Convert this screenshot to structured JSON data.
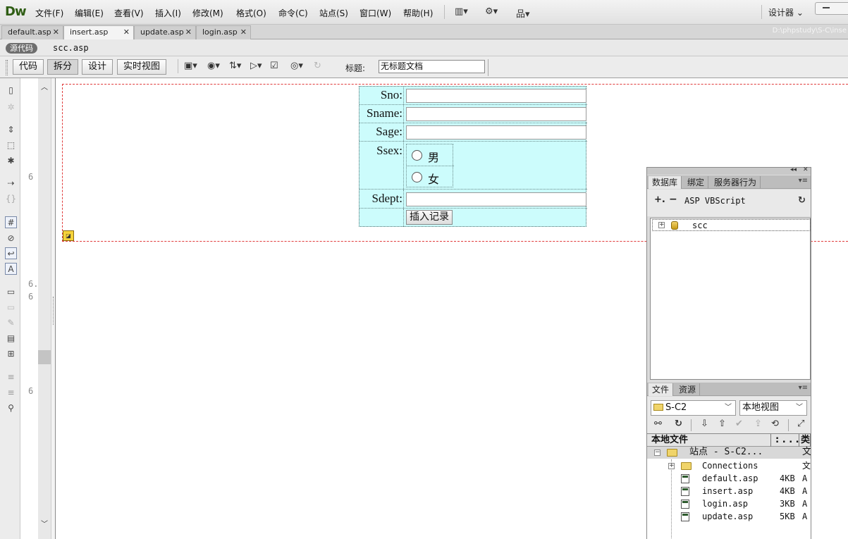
{
  "app": {
    "logo": "Dw",
    "menu": [
      "文件(F)",
      "编辑(E)",
      "查看(V)",
      "插入(I)",
      "修改(M)",
      "格式(O)",
      "命令(C)",
      "站点(S)",
      "窗口(W)",
      "帮助(H)"
    ],
    "workspace": "设计器"
  },
  "doc_tabs": [
    {
      "label": "default.asp",
      "active": false
    },
    {
      "label": "insert.asp",
      "active": true
    },
    {
      "label": "update.asp",
      "active": false
    },
    {
      "label": "login.asp",
      "active": false
    }
  ],
  "doc_path": "D:\\phpstudy\\S-C\\inse",
  "related": {
    "source": "源代码",
    "file": "scc.asp"
  },
  "toolbar": {
    "views": [
      "代码",
      "拆分",
      "设计",
      "实时视图"
    ],
    "active_view": "拆分",
    "title_label": "标题:",
    "title_value": "无标题文档"
  },
  "gutter": {
    "numbers": [
      "6",
      "6.",
      "6",
      "6"
    ]
  },
  "form": {
    "fields": [
      {
        "label": "Sno:",
        "value": ""
      },
      {
        "label": "Sname:",
        "value": ""
      },
      {
        "label": "Sage:",
        "value": ""
      }
    ],
    "ssex": {
      "label": "Ssex:",
      "options": [
        "男",
        "女"
      ]
    },
    "sdept": {
      "label": "Sdept:",
      "value": ""
    },
    "submit": "插入记录"
  },
  "panel_db": {
    "tabs": [
      "数据库",
      "绑定",
      "服务器行为"
    ],
    "active_tab": "数据库",
    "language": "ASP VBScript",
    "connections": [
      "scc"
    ]
  },
  "panel_files": {
    "tabs": [
      "文件",
      "资源"
    ],
    "active_tab": "文件",
    "site": "S-C2",
    "view": "本地视图",
    "columns": [
      "本地文件",
      ": . . .",
      "类"
    ],
    "site_node": {
      "label": "站点 - S-C2...",
      "type": "文"
    },
    "items": [
      {
        "name": "Connections",
        "size": "",
        "type": "文",
        "kind": "folder"
      },
      {
        "name": "default.asp",
        "size": "4KB",
        "type": "A",
        "kind": "file"
      },
      {
        "name": "insert.asp",
        "size": "4KB",
        "type": "A",
        "kind": "file"
      },
      {
        "name": "login.asp",
        "size": "3KB",
        "type": "A",
        "kind": "file"
      },
      {
        "name": "update.asp",
        "size": "5KB",
        "type": "A",
        "kind": "file"
      }
    ]
  },
  "colors": {
    "form_bg": "#ccfcfc",
    "form_border_dashed": "#e03a3a",
    "logo": "#2f5d14"
  }
}
